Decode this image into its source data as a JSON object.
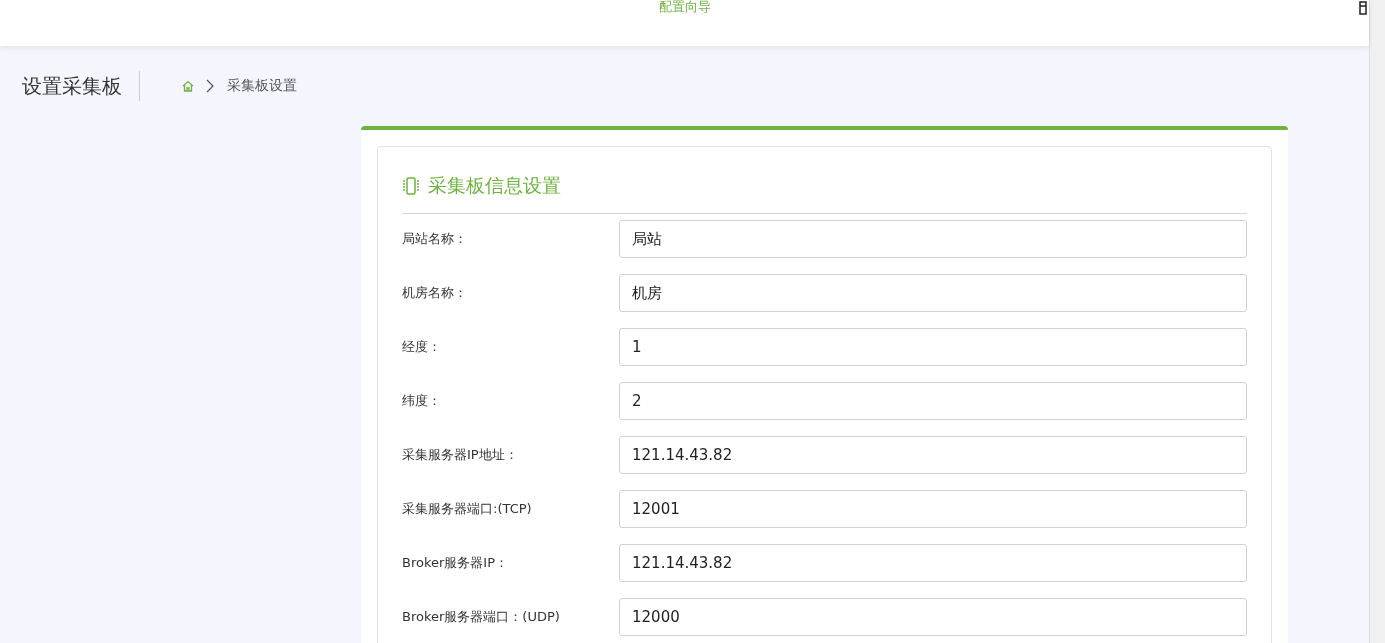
{
  "header": {
    "title": "配置向导"
  },
  "page": {
    "title": "设置采集板",
    "breadcrumb": [
      "采集板设置"
    ]
  },
  "card": {
    "title": "采集板信息设置",
    "fields": [
      {
        "label": "局站名称：",
        "value": "局站"
      },
      {
        "label": "机房名称：",
        "value": "机房"
      },
      {
        "label": "经度：",
        "value": "1"
      },
      {
        "label": "纬度：",
        "value": "2"
      },
      {
        "label": "采集服务器IP地址：",
        "value": "121.14.43.82"
      },
      {
        "label": "采集服务器端口:(TCP)",
        "value": "12001"
      },
      {
        "label": "Broker服务器IP：",
        "value": "121.14.43.82"
      },
      {
        "label": "Broker服务器端口：(UDP)",
        "value": "12000"
      }
    ]
  }
}
